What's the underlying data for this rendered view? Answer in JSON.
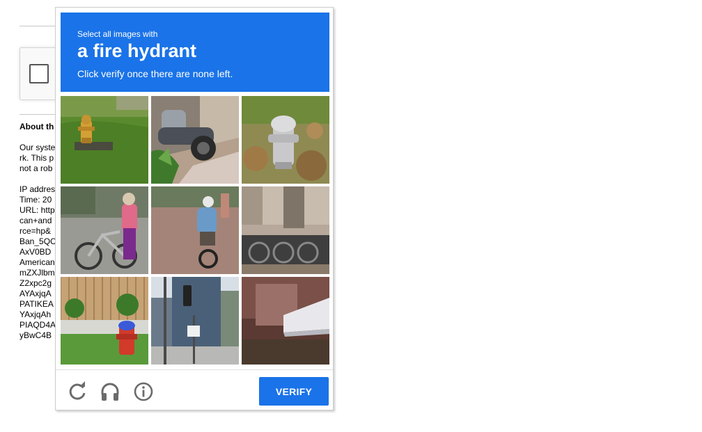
{
  "background_page": {
    "about_heading": "About th",
    "paragraph_lines": "Our syste\nrk. This p\nnot a rob",
    "info_lines": "IP addres\nTime: 20\nURL: http\ncan+and\nrce=hp&\nBan_5QC\nAxV0BD\nAmerican\nmZXJlbm\nZ2xpc2g\nAYAxjqA\nPATIKEA\nYAxjqAh\nPIAQD4A\nyBwC4B"
  },
  "challenge": {
    "instruction_small": "Select all images with",
    "target_object": "a fire hydrant",
    "instruction_sub": "Click verify once there are none left.",
    "header_color": "#1a73e8",
    "tiles": [
      {
        "content": "yellow fire hydrant on grass"
      },
      {
        "content": "motorcycle on sidewalk"
      },
      {
        "content": "silver fire hydrant in leaves"
      },
      {
        "content": "woman with bicycle"
      },
      {
        "content": "cyclist on brick path"
      },
      {
        "content": "parked bicycles"
      },
      {
        "content": "red and blue fire hydrant by fence"
      },
      {
        "content": "traffic light and buildings"
      },
      {
        "content": "awning on storefront"
      }
    ],
    "footer": {
      "reload_icon": "reload-icon",
      "audio_icon": "headphones-icon",
      "info_icon": "info-icon",
      "verify_label": "VERIFY"
    }
  }
}
